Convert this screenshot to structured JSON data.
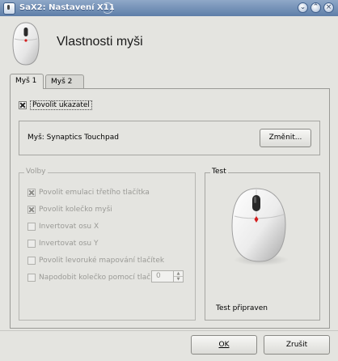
{
  "window": {
    "title": "SaX2: Nastavení X11",
    "buttons": [
      "minimize",
      "maximize",
      "close"
    ]
  },
  "header": {
    "title": "Vlastnosti myši",
    "icon": "mouse-icon"
  },
  "tabs": [
    {
      "label": "Myš 1",
      "active": true
    },
    {
      "label": "Myš 2",
      "active": false
    }
  ],
  "panel": {
    "enable_pointer": {
      "label": "Povolit ukazatel",
      "checked": true
    },
    "mouse": {
      "label": "Myš: Synaptics Touchpad",
      "change_button": "Změnit..."
    },
    "options": {
      "title": "Volby",
      "items": [
        {
          "label": "Povolit emulaci třetího tlačítka",
          "checked": true
        },
        {
          "label": "Povolit kolečko myši",
          "checked": true
        },
        {
          "label": "Invertovat osu X",
          "checked": false
        },
        {
          "label": "Invertovat osu Y",
          "checked": false
        },
        {
          "label": "Povolit levoruké mapování tlačítek",
          "checked": false
        },
        {
          "label": "Napodobit kolečko pomocí tlačítka",
          "checked": false
        }
      ],
      "wheel_button_value": "0"
    },
    "test": {
      "title": "Test",
      "status": "Test připraven"
    }
  },
  "footer": {
    "ok_label": "OK",
    "cancel_label": "Zrušit"
  },
  "colors": {
    "titlebar": "#5e7ea8",
    "background": "#e4e4e0",
    "mouse_accent": "#d41c1c"
  }
}
